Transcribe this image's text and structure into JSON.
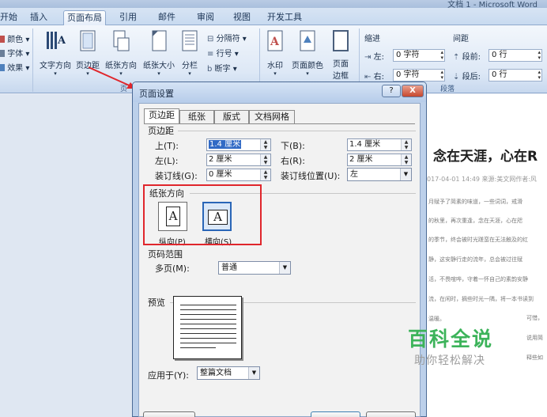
{
  "window": {
    "doc_title": "文档 1 - Microsoft Word"
  },
  "ribbon_tabs": [
    {
      "label": "开始",
      "active": false
    },
    {
      "label": "插入",
      "active": false
    },
    {
      "label": "页面布局",
      "active": true
    },
    {
      "label": "引用",
      "active": false
    },
    {
      "label": "邮件",
      "active": false
    },
    {
      "label": "审阅",
      "active": false
    },
    {
      "label": "视图",
      "active": false
    },
    {
      "label": "开发工具",
      "active": false
    }
  ],
  "ribbon": {
    "theme": {
      "colors": "颜色",
      "fonts": "字体",
      "effects": "效果"
    },
    "page_setup": {
      "text_direction": "文字方向",
      "margins": "页边距",
      "orientation": "纸张方向",
      "size": "纸张大小",
      "columns": "分栏",
      "breaks": "分隔符",
      "line_numbers": "行号",
      "hyphenation": "断字"
    },
    "page_background": {
      "watermark": "水印",
      "page_color": "页面颜色",
      "page_borders_1": "页面",
      "page_borders_2": "边框"
    },
    "indent": {
      "title": "缩进",
      "left_label": "左:",
      "left_value": "0 字符",
      "right_label": "右:",
      "right_value": "0 字符"
    },
    "spacing": {
      "title": "间距",
      "before_label": "段前:",
      "before_value": "0 行",
      "after_label": "段后:",
      "after_value": "0 行"
    },
    "paragraph_group": "段落",
    "page_setup_group_tail": "页"
  },
  "document": {
    "heading": "念在天涯，心在R",
    "meta": "017-04-01 14:49 来源:美文网作者:风",
    "lines": [
      "月赋予了简素的味道，一些词词，戒滑",
      "的秋里，再次重逢，念在天涯，心在咫",
      "的季节，终会被时光蹉蛮在无法触及的红",
      "静，这安静行走的流年，总会被过往赋",
      "活，不畏喧哗，守着一怀自己的素韵安静",
      "流，在闲时，摘些时光一隅，将一本书读到",
      "温暖。"
    ],
    "side_notes": [
      "可惜，",
      "说用简",
      "释些如"
    ]
  },
  "watermark": {
    "big": "百科全说",
    "small": "助你轻松解决"
  },
  "dialog": {
    "title": "页面设置",
    "help": "?",
    "close": "X",
    "tabs": [
      {
        "label": "页边距",
        "active": true
      },
      {
        "label": "纸张",
        "active": false
      },
      {
        "label": "版式",
        "active": false
      },
      {
        "label": "文档网格",
        "active": false
      }
    ],
    "margins_title": "页边距",
    "top_label": "上(T):",
    "top_value": "1.4 厘米",
    "bottom_label": "下(B):",
    "bottom_value": "1.4 厘米",
    "left_label": "左(L):",
    "left_value": "2 厘米",
    "right_label": "右(R):",
    "right_value": "2 厘米",
    "gutter_label": "装订线(G):",
    "gutter_value": "0 厘米",
    "gutter_pos_label": "装订线位置(U):",
    "gutter_pos_value": "左",
    "orientation_title": "纸张方向",
    "portrait_label": "纵向(P)",
    "landscape_label": "横向(S)",
    "orientation_glyph": "A",
    "pages_title": "页码范围",
    "multiple_pages_label": "多页(M):",
    "multiple_pages_value": "普通",
    "preview_title": "预览",
    "apply_to_label": "应用于(Y):",
    "apply_to_value": "整篇文档"
  }
}
